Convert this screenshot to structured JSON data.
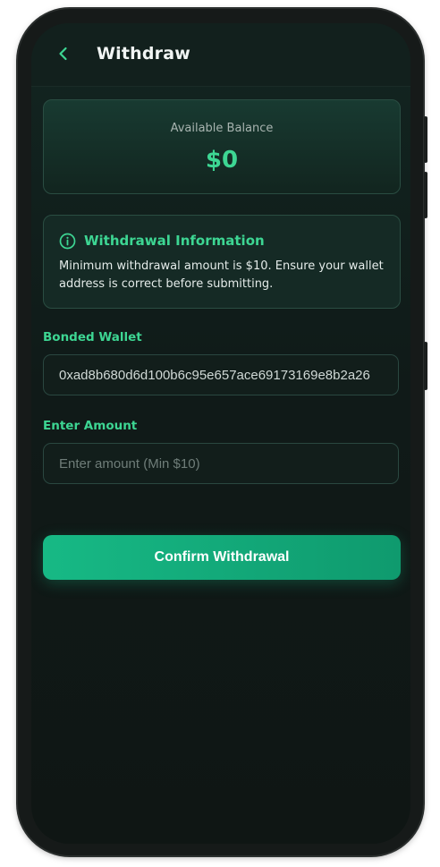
{
  "header": {
    "title": "Withdraw",
    "back_icon": "chevron-left-icon"
  },
  "balance": {
    "label": "Available Balance",
    "value": "$0"
  },
  "info": {
    "icon": "info-circle-icon",
    "title": "Withdrawal Information",
    "text": "Minimum withdrawal amount is $10. Ensure your wallet address is correct before submitting."
  },
  "wallet": {
    "label": "Bonded Wallet",
    "value": "0xad8b680d6d100b6c95e657ace69173169e8b2a26"
  },
  "amount": {
    "label": "Enter Amount",
    "value": "",
    "placeholder": "Enter amount (Min $10)"
  },
  "confirm_label": "Confirm Withdrawal",
  "colors": {
    "accent": "#3dd693",
    "button": "#17b985",
    "background": "#101a18"
  }
}
